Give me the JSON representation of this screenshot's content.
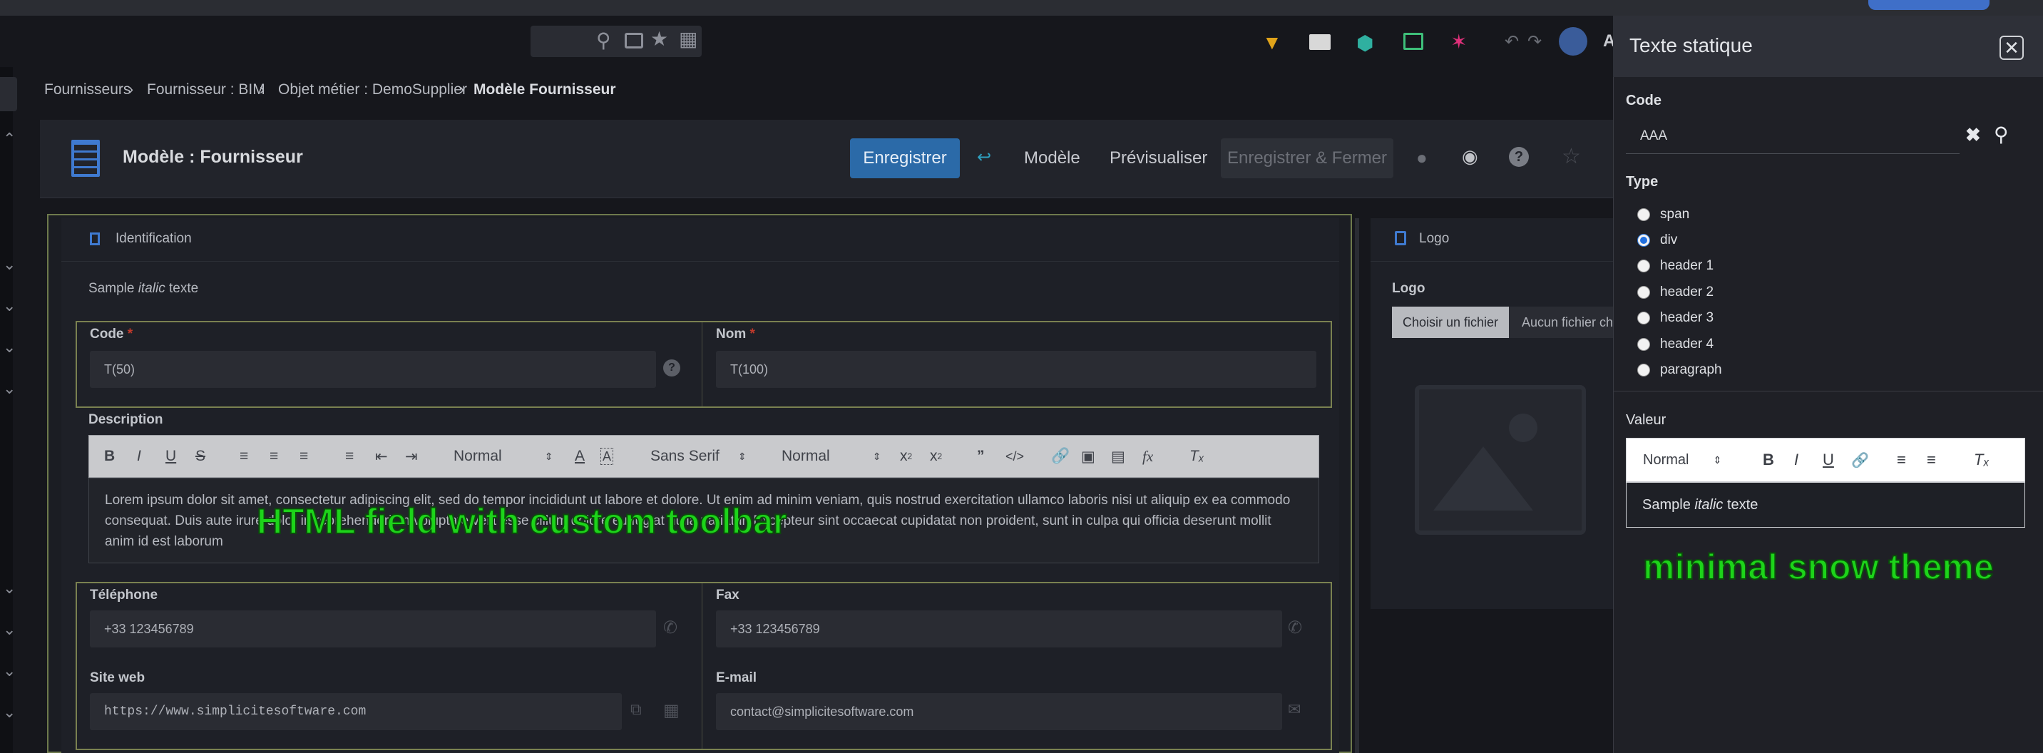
{
  "topbar": {
    "ellipsis": "A"
  },
  "breadcrumb": {
    "items": [
      "Fournisseurs",
      "Fournisseur : BIM",
      "Objet métier : DemoSupplier"
    ],
    "current": "Modèle Fournisseur",
    "separator": "›"
  },
  "form": {
    "title": "Modèle : Fournisseur",
    "save_label": "Enregistrer",
    "model_label": "Modèle",
    "preview_label": "Prévisualiser",
    "save_close_label": "Enregistrer & Fermer",
    "identification_title": "Identification",
    "sample_prefix": "Sample",
    "sample_italic": "italic",
    "sample_suffix": "texte",
    "code": {
      "label": "Code",
      "required": "*",
      "placeholder": "T(50)"
    },
    "nom": {
      "label": "Nom",
      "required": "*",
      "placeholder": "T(100)"
    },
    "description": {
      "label": "Description",
      "toolbar": {
        "header_select": "Normal",
        "font_select": "Sans Serif",
        "size_select": "Normal"
      },
      "text": "Lorem ipsum dolor sit amet, consectetur adipiscing elit, sed do tempor incididunt ut labore et dolore. Ut enim ad minim veniam, quis nostrud exercitation ullamco laboris nisi ut aliquip ex ea commodo consequat. Duis aute irure dolor in reprehenderit in voluptate velit esse cillum dolore eu fugiat nulla pariatur. Excepteur sint occaecat cupidatat non proident, sunt in culpa qui officia deserunt mollit anim id est laborum"
    },
    "telephone": {
      "label": "Téléphone",
      "value": "+33 123456789"
    },
    "fax": {
      "label": "Fax",
      "value": "+33 123456789"
    },
    "site_web": {
      "label": "Site web",
      "value": "https://www.simplicitesoftware.com"
    },
    "email": {
      "label": "E-mail",
      "value": "contact@simplicitesoftware.com"
    }
  },
  "logo_card": {
    "title": "Logo",
    "field_label": "Logo",
    "choose_button": "Choisir un fichier",
    "no_file_text": "Aucun fichier choisi"
  },
  "annotations": {
    "html_field": "HTML field with custom toolbar",
    "snow_theme": "minimal snow theme"
  },
  "panel": {
    "title": "Texte statique",
    "code_label": "Code",
    "code_value": "AAA",
    "type_label": "Type",
    "type_options": [
      "span",
      "div",
      "header 1",
      "header 2",
      "header 3",
      "header 4",
      "paragraph"
    ],
    "type_selected": "div",
    "value_label": "Valeur",
    "value_toolbar_select": "Normal",
    "value_prefix": "Sample",
    "value_italic": "italic",
    "value_suffix": "texte"
  },
  "colors": {
    "primary": "#2b6aa8",
    "group_border": "#7a8150",
    "annotation_green": "#1dd41a"
  }
}
